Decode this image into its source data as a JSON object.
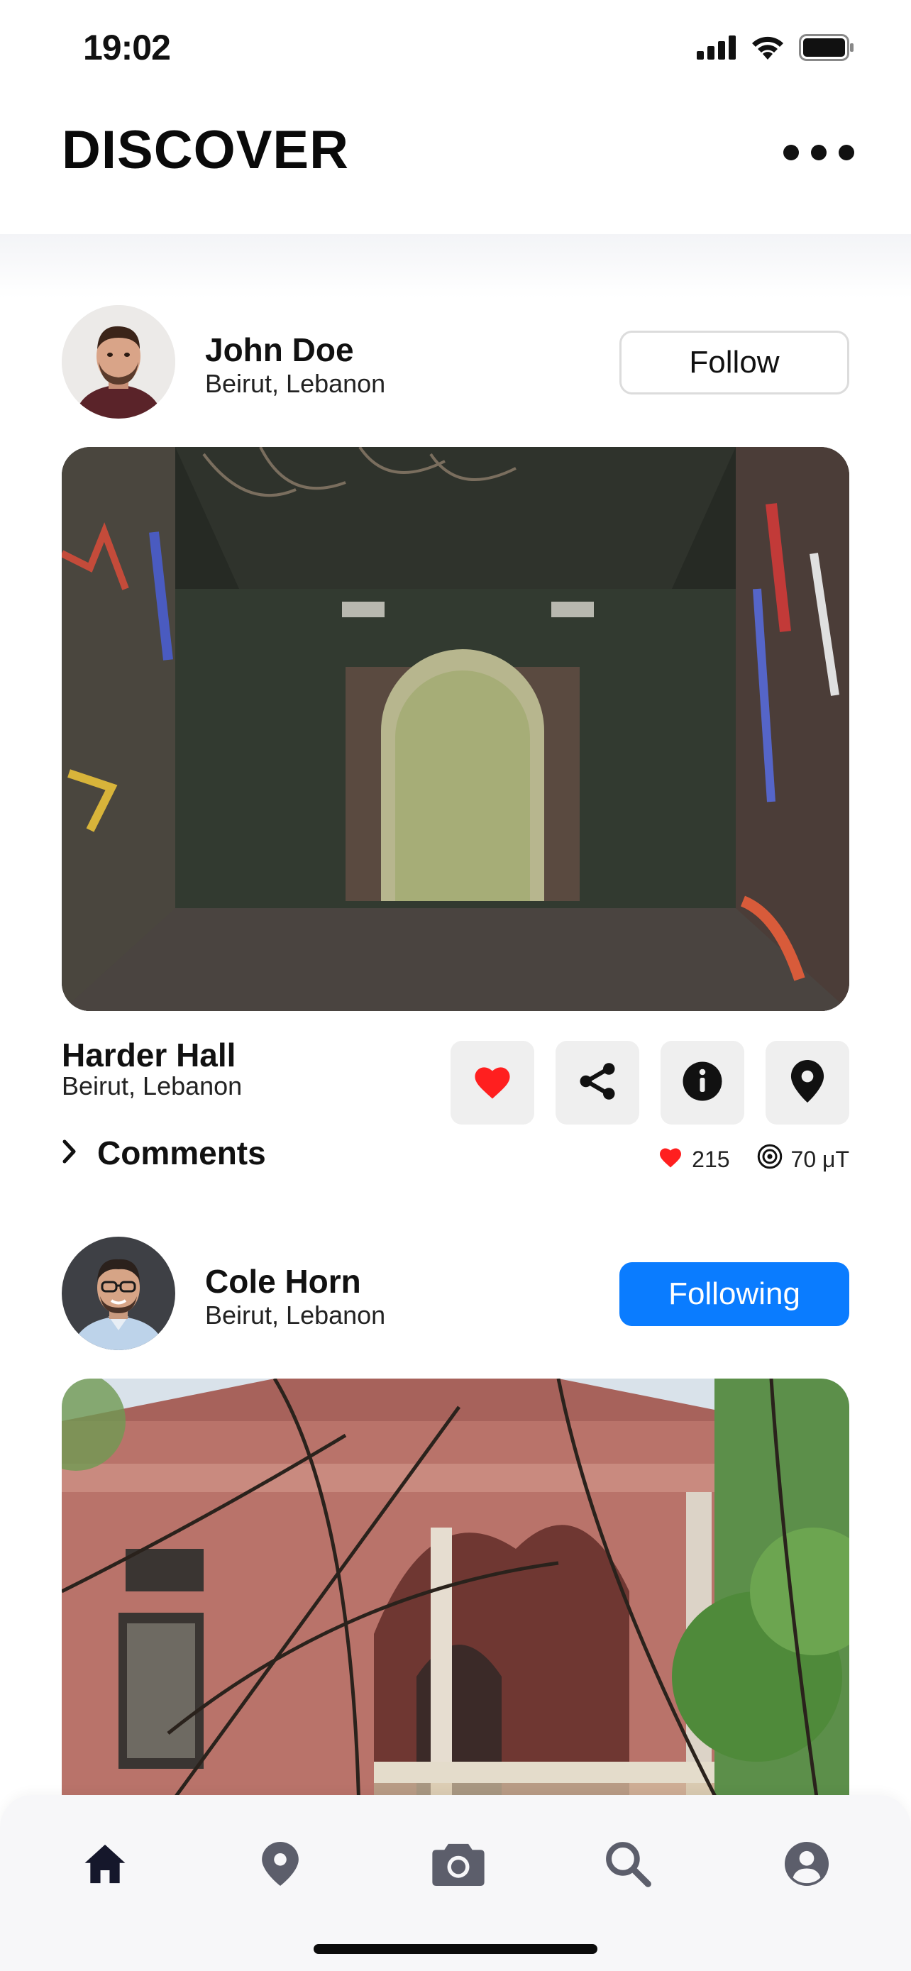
{
  "status_bar": {
    "time": "19:02"
  },
  "header": {
    "title": "DISCOVER"
  },
  "posts": [
    {
      "author": "John Doe",
      "author_location": "Beirut, Lebanon",
      "follow_label": "Follow",
      "place_name": "Harder Hall",
      "place_location": "Beirut, Lebanon",
      "comments_label": "Comments",
      "likes": "215",
      "signal": "70 μT",
      "liked": true
    },
    {
      "author": "Cole Horn",
      "author_location": "Beirut, Lebanon",
      "follow_label": "Following"
    }
  ],
  "nav": {
    "items": [
      "home-icon",
      "location-pin-icon",
      "camera-icon",
      "search-icon",
      "account-icon"
    ],
    "active": "home-icon"
  },
  "colors": {
    "accent_blue": "#0a7cff",
    "like_red": "#ff1f1f",
    "nav_active": "#15172b",
    "nav_inactive": "#5c5e6b"
  }
}
